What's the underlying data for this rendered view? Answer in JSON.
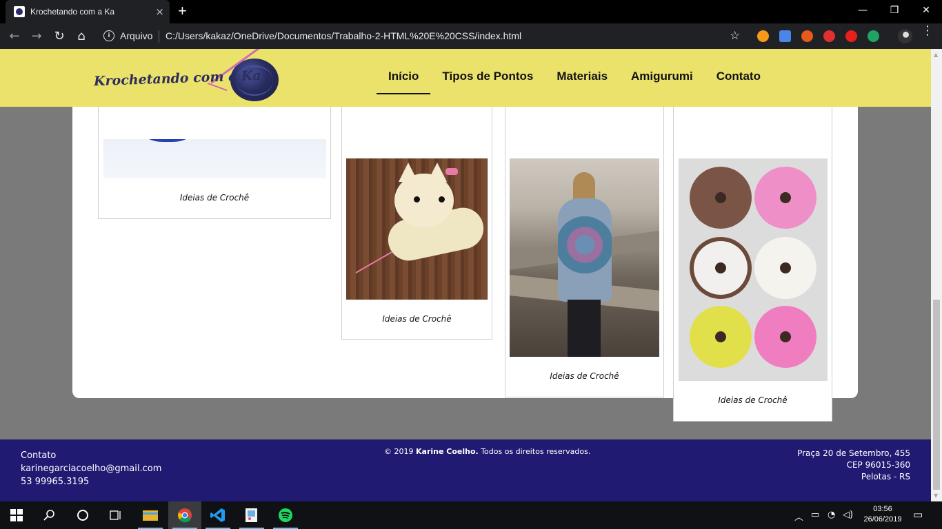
{
  "browser": {
    "tab_title": "Krochetando com a Ka",
    "tab_close": "×",
    "new_tab": "+",
    "window_controls": {
      "minimize": "—",
      "maximize": "❐",
      "close": "✕"
    },
    "nav": {
      "back": "←",
      "forward": "→",
      "reload": "↻",
      "home": "⌂"
    },
    "security_label": "Arquivo",
    "url": "C:/Users/kakaz/OneDrive/Documentos/Trabalho-2-HTML%20E%20CSS/index.html",
    "bookmark": "☆",
    "menu": "⋮"
  },
  "site": {
    "logo_text": "Krochetando com a Ka",
    "nav": [
      "Início",
      "Tipos de Pontos",
      "Materiais",
      "Amigurumi",
      "Contato"
    ],
    "active_nav_index": 0
  },
  "gallery": [
    {
      "caption": "Ideias de Crochê",
      "image": "blue-yarn-photo"
    },
    {
      "caption": "Ideias de Crochê",
      "image": "amigurumi-cat-photo"
    },
    {
      "caption": "Ideias de Crochê",
      "image": "crochet-cardigan-photo"
    },
    {
      "caption": "Ideias de Crochê",
      "image": "crochet-donuts-photo"
    }
  ],
  "footer": {
    "left": [
      "Contato",
      "karinegarciacoelho@gmail.com",
      "53 99965.3195"
    ],
    "copyright_prefix": "© 2019",
    "copyright_name": "Karine Coelho.",
    "copyright_suffix": "Todos os direitos reservados.",
    "address": [
      "Praça 20 de Setembro, 455",
      "CEP 96015-360",
      "Pelotas - RS"
    ]
  },
  "taskbar": {
    "time": "03:56",
    "date": "26/06/2019",
    "apps": [
      "start",
      "search",
      "cortana",
      "task-view",
      "file-explorer",
      "chrome",
      "vscode",
      "paint",
      "spotify"
    ]
  },
  "colors": {
    "header_bg": "#ebe26b",
    "footer_bg": "#211a73",
    "page_bg": "#7a7a7a"
  }
}
